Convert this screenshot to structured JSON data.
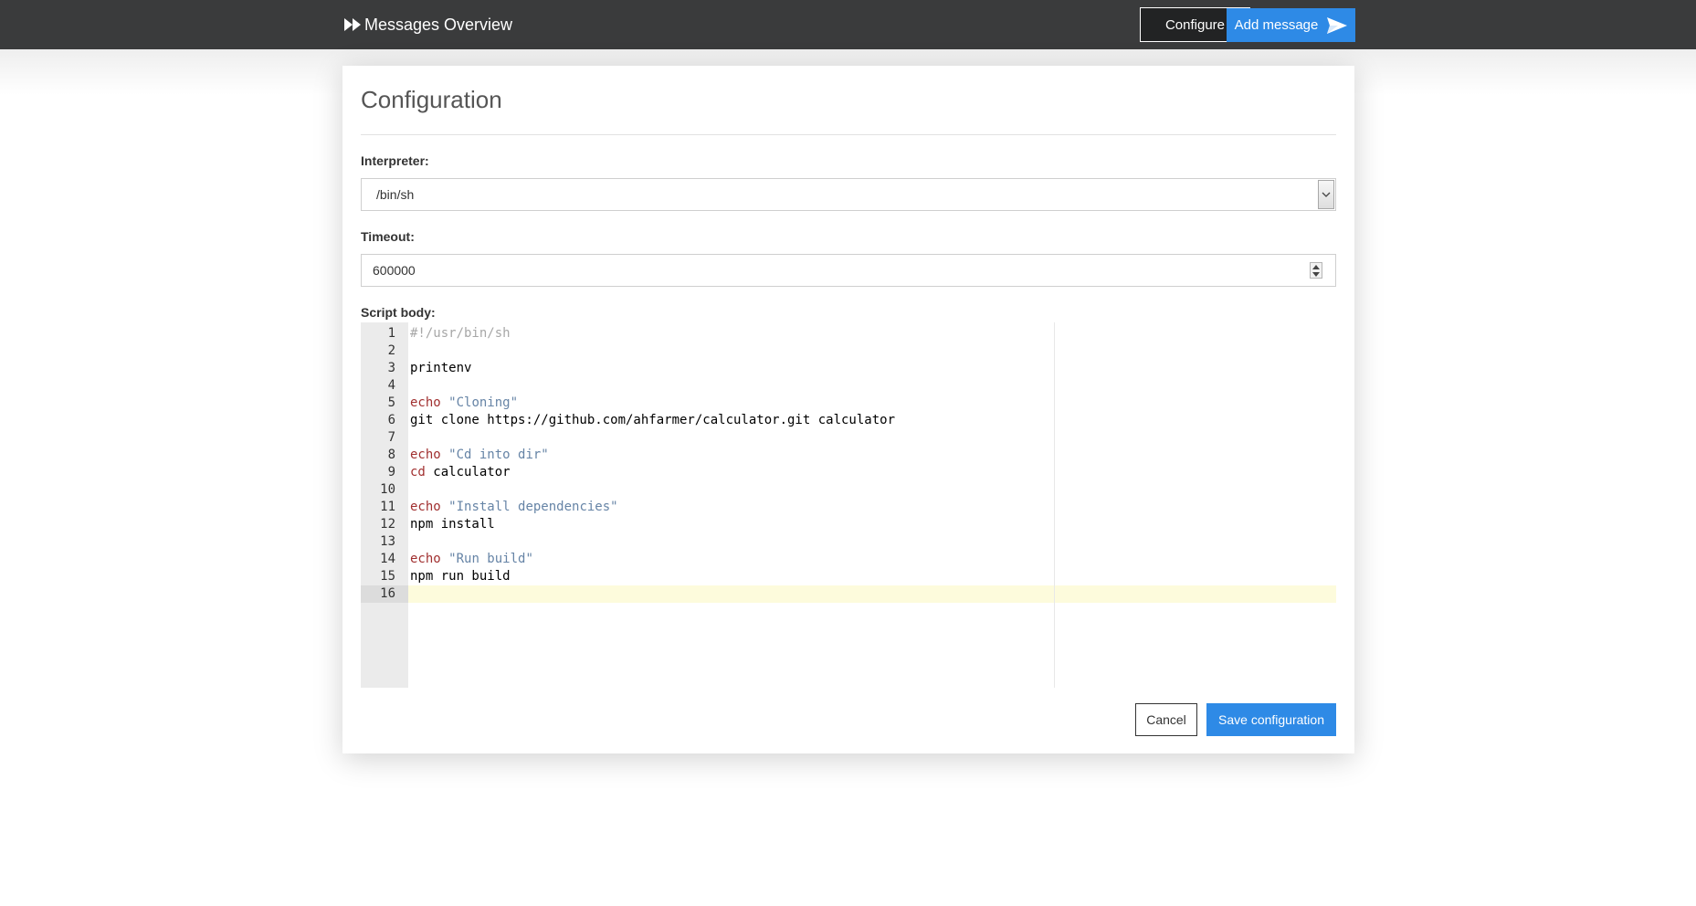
{
  "navbar": {
    "brand_icon": "fast-forward-icon",
    "title": "Messages Overview",
    "configure_label": "Configure",
    "add_message_label": "Add message",
    "add_message_icon": "send-icon",
    "accent_color": "#2e8ae6"
  },
  "modal": {
    "title": "Configuration",
    "interpreter": {
      "label": "Interpreter:",
      "selected": "/bin/sh"
    },
    "timeout": {
      "label": "Timeout:",
      "value": "600000"
    },
    "script": {
      "label": "Script body:",
      "active_line": 16,
      "lines": [
        {
          "n": "1",
          "tokens": [
            {
              "t": "#!/usr/bin/sh",
              "c": "comment"
            }
          ]
        },
        {
          "n": "2",
          "tokens": []
        },
        {
          "n": "3",
          "tokens": [
            {
              "t": "printenv",
              "c": "plain"
            }
          ]
        },
        {
          "n": "4",
          "tokens": []
        },
        {
          "n": "5",
          "tokens": [
            {
              "t": "echo",
              "c": "keyword"
            },
            {
              "t": " ",
              "c": "plain"
            },
            {
              "t": "\"Cloning\"",
              "c": "string"
            }
          ]
        },
        {
          "n": "6",
          "tokens": [
            {
              "t": "git clone https://github.com/ahfarmer/calculator.git calculator",
              "c": "plain"
            }
          ]
        },
        {
          "n": "7",
          "tokens": []
        },
        {
          "n": "8",
          "tokens": [
            {
              "t": "echo",
              "c": "keyword"
            },
            {
              "t": " ",
              "c": "plain"
            },
            {
              "t": "\"Cd into dir\"",
              "c": "string"
            }
          ]
        },
        {
          "n": "9",
          "tokens": [
            {
              "t": "cd",
              "c": "keyword"
            },
            {
              "t": " calculator",
              "c": "plain"
            }
          ]
        },
        {
          "n": "10",
          "tokens": []
        },
        {
          "n": "11",
          "tokens": [
            {
              "t": "echo",
              "c": "keyword"
            },
            {
              "t": " ",
              "c": "plain"
            },
            {
              "t": "\"Install dependencies\"",
              "c": "string"
            }
          ]
        },
        {
          "n": "12",
          "tokens": [
            {
              "t": "npm install",
              "c": "plain"
            }
          ]
        },
        {
          "n": "13",
          "tokens": []
        },
        {
          "n": "14",
          "tokens": [
            {
              "t": "echo",
              "c": "keyword"
            },
            {
              "t": " ",
              "c": "plain"
            },
            {
              "t": "\"Run build\"",
              "c": "string"
            }
          ]
        },
        {
          "n": "15",
          "tokens": [
            {
              "t": "npm run build",
              "c": "plain"
            }
          ]
        },
        {
          "n": "16",
          "tokens": []
        }
      ]
    },
    "cancel_label": "Cancel",
    "save_label": "Save configuration"
  }
}
